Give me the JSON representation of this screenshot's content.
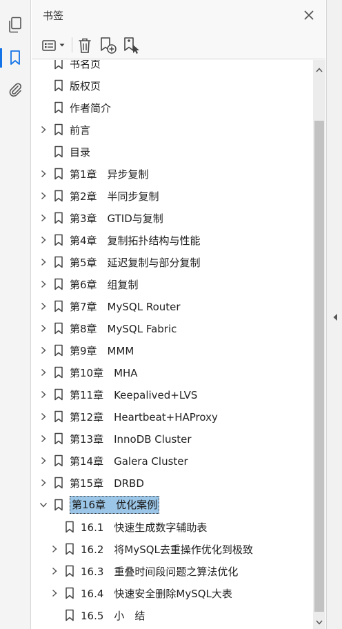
{
  "panel": {
    "title": "书签",
    "icons": {
      "close": "close-icon",
      "options": "list-options-icon",
      "delete": "trash-icon",
      "new_bookmark": "new-bookmark-icon",
      "new_from_structure": "bookmark-structure-icon"
    }
  },
  "rail": {
    "items": [
      {
        "icon": "pages-icon",
        "active": false
      },
      {
        "icon": "bookmark-icon",
        "active": true
      },
      {
        "icon": "attachment-icon",
        "active": false
      }
    ]
  },
  "bookmarks": [
    {
      "label": "书名页",
      "level": 0,
      "expandable": false,
      "expanded": false,
      "selected": false
    },
    {
      "label": "版权页",
      "level": 0,
      "expandable": false,
      "expanded": false,
      "selected": false
    },
    {
      "label": "作者简介",
      "level": 0,
      "expandable": false,
      "expanded": false,
      "selected": false
    },
    {
      "label": "前言",
      "level": 0,
      "expandable": true,
      "expanded": false,
      "selected": false
    },
    {
      "label": "目录",
      "level": 0,
      "expandable": false,
      "expanded": false,
      "selected": false
    },
    {
      "label": "第1章　异步复制",
      "level": 0,
      "expandable": true,
      "expanded": false,
      "selected": false
    },
    {
      "label": "第2章　半同步复制",
      "level": 0,
      "expandable": true,
      "expanded": false,
      "selected": false
    },
    {
      "label": "第3章　GTID与复制",
      "level": 0,
      "expandable": true,
      "expanded": false,
      "selected": false
    },
    {
      "label": "第4章　复制拓扑结构与性能",
      "level": 0,
      "expandable": true,
      "expanded": false,
      "selected": false
    },
    {
      "label": "第5章　延迟复制与部分复制",
      "level": 0,
      "expandable": true,
      "expanded": false,
      "selected": false
    },
    {
      "label": "第6章　组复制",
      "level": 0,
      "expandable": true,
      "expanded": false,
      "selected": false
    },
    {
      "label": "第7章　MySQL Router",
      "level": 0,
      "expandable": true,
      "expanded": false,
      "selected": false
    },
    {
      "label": "第8章　MySQL Fabric",
      "level": 0,
      "expandable": true,
      "expanded": false,
      "selected": false
    },
    {
      "label": "第9章　MMM",
      "level": 0,
      "expandable": true,
      "expanded": false,
      "selected": false
    },
    {
      "label": "第10章　MHA",
      "level": 0,
      "expandable": true,
      "expanded": false,
      "selected": false
    },
    {
      "label": "第11章　Keepalived+LVS",
      "level": 0,
      "expandable": true,
      "expanded": false,
      "selected": false
    },
    {
      "label": "第12章　Heartbeat+HAProxy",
      "level": 0,
      "expandable": true,
      "expanded": false,
      "selected": false
    },
    {
      "label": "第13章　InnoDB Cluster",
      "level": 0,
      "expandable": true,
      "expanded": false,
      "selected": false
    },
    {
      "label": "第14章　Galera Cluster",
      "level": 0,
      "expandable": true,
      "expanded": false,
      "selected": false
    },
    {
      "label": "第15章　DRBD",
      "level": 0,
      "expandable": true,
      "expanded": false,
      "selected": false
    },
    {
      "label": "第16章　优化案例",
      "level": 0,
      "expandable": true,
      "expanded": true,
      "selected": true
    },
    {
      "label": "16.1　快速生成数字辅助表",
      "level": 1,
      "expandable": false,
      "expanded": false,
      "selected": false
    },
    {
      "label": "16.2　将MySQL去重操作优化到极致",
      "level": 1,
      "expandable": true,
      "expanded": false,
      "selected": false
    },
    {
      "label": "16.3　重叠时间段问题之算法优化",
      "level": 1,
      "expandable": true,
      "expanded": false,
      "selected": false
    },
    {
      "label": "16.4　快速安全删除MySQL大表",
      "level": 1,
      "expandable": true,
      "expanded": false,
      "selected": false
    },
    {
      "label": "16.5　小　结",
      "level": 1,
      "expandable": false,
      "expanded": false,
      "selected": false
    }
  ],
  "colors": {
    "selection": "#9bc6e8",
    "accent": "#1473e6",
    "icon": "#555555"
  }
}
